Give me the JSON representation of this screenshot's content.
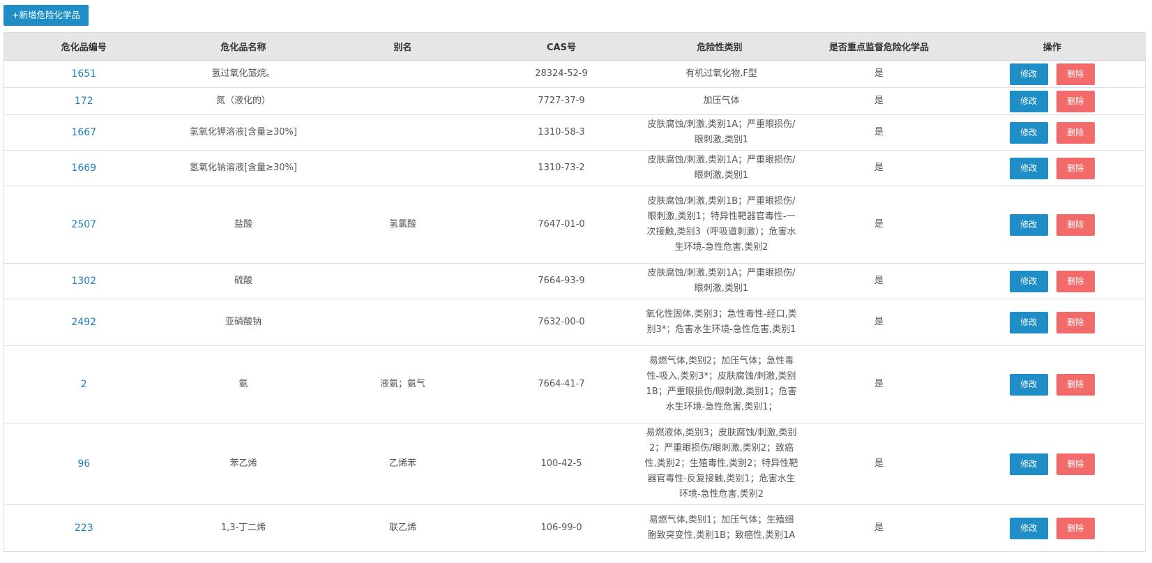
{
  "toolbar": {
    "add_label": "+新增危险化学品"
  },
  "table": {
    "headers": [
      "危化品编号",
      "危化品名称",
      "别名",
      "CAS号",
      "危险性类别",
      "是否重点监督危险化学品",
      "操作"
    ],
    "edit_label": "修改",
    "delete_label": "删除",
    "rows": [
      {
        "code": "1651",
        "name": "氢过氧化蒎烷。",
        "alias": "",
        "cas": "28324-52-9",
        "hazard": "有机过氧化物,F型",
        "key": "是"
      },
      {
        "code": "172",
        "name": "氮（液化的）",
        "alias": "",
        "cas": "7727-37-9",
        "hazard": "加压气体",
        "key": "是"
      },
      {
        "code": "1667",
        "name": "氢氧化钾溶液[含量≥30%]",
        "alias": "",
        "cas": "1310-58-3",
        "hazard": "皮肤腐蚀/刺激,类别1A；严重眼损伤/眼刺激,类别1",
        "key": "是"
      },
      {
        "code": "1669",
        "name": "氢氧化钠溶液[含量≥30%]",
        "alias": "",
        "cas": "1310-73-2",
        "hazard": "皮肤腐蚀/刺激,类别1A；严重眼损伤/眼刺激,类别1",
        "key": "是"
      },
      {
        "code": "2507",
        "name": "盐酸",
        "alias": "氢氯酸",
        "cas": "7647-01-0",
        "hazard": "皮肤腐蚀/刺激,类别1B；严重眼损伤/眼刺激,类别1；特异性靶器官毒性-一次接触,类别3（呼吸道刺激）；危害水生环境-急性危害,类别2",
        "key": "是"
      },
      {
        "code": "1302",
        "name": "硫酸",
        "alias": "",
        "cas": "7664-93-9",
        "hazard": "皮肤腐蚀/刺激,类别1A；严重眼损伤/眼刺激,类别1",
        "key": "是"
      },
      {
        "code": "2492",
        "name": "亚硝酸钠",
        "alias": "",
        "cas": "7632-00-0",
        "hazard": "氧化性固体,类别3；急性毒性-经口,类别3*；危害水生环境-急性危害,类别1",
        "key": "是"
      },
      {
        "code": "2",
        "name": "氨",
        "alias": "液氨；氨气",
        "cas": "7664-41-7",
        "hazard": "易燃气体,类别2；加压气体；急性毒性-吸入,类别3*；皮肤腐蚀/刺激,类别1B；严重眼损伤/眼刺激,类别1；危害水生环境-急性危害,类别1；",
        "key": "是"
      },
      {
        "code": "96",
        "name": "苯乙烯",
        "alias": "乙烯苯",
        "cas": "100-42-5",
        "hazard": "易燃液体,类别3；皮肤腐蚀/刺激,类别2；严重眼损伤/眼刺激,类别2；致癌性,类别2；生殖毒性,类别2；特异性靶器官毒性-反复接触,类别1；危害水生环境-急性危害,类别2",
        "key": "是"
      },
      {
        "code": "223",
        "name": "1,3-丁二烯",
        "alias": "联乙烯",
        "cas": "106-99-0",
        "hazard": "易燃气体,类别1；加压气体；生殖细胞致突变性,类别1B；致癌性,类别1A",
        "key": "是"
      }
    ]
  }
}
